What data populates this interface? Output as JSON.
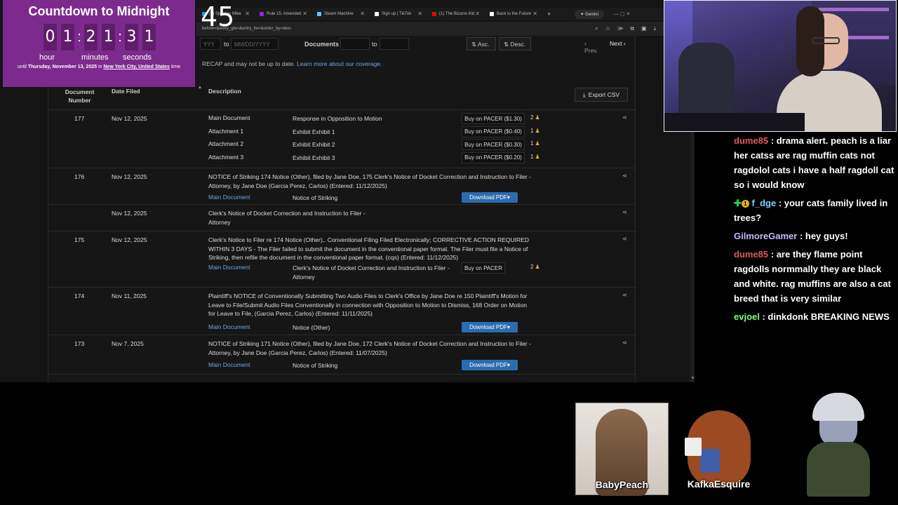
{
  "browser": {
    "tabs": [
      {
        "label": "(1) Speaker Mike",
        "color": "#1d9bf0"
      },
      {
        "label": "Rule 15: Amended",
        "color": "#8a2be2"
      },
      {
        "label": "Steam Machine",
        "color": "#66c0f4"
      },
      {
        "label": "Sign up | TikTok",
        "color": "#ffffff"
      },
      {
        "label": "(1) The Bizarre Kid",
        "color": "#ff0000"
      },
      {
        "label": "Back to the Future",
        "color": "#ffffff"
      }
    ],
    "gemini_label": "Gemini",
    "new_tab": "+",
    "window_controls": "—  ▢  ✕",
    "url": "before=&entry_gte=&entry_lte=&order_by=desc"
  },
  "controls": {
    "date_to_start_placeholder": "YYY",
    "to_label_1": "to",
    "date_end_placeholder": "MM/DD/YYYY",
    "documents_label": "Documents",
    "to_label_2": "to",
    "asc_label": "Asc.",
    "desc_label": "Desc.",
    "prev_label": "‹ Prev.",
    "next_label": "Next ›"
  },
  "notice": {
    "text": "RECAP and may not be up to date.",
    "link": "Learn more about our coverage."
  },
  "table": {
    "headers": {
      "doc_number_1": "Document",
      "doc_number_2": "Number",
      "date_filed": "Date Filed",
      "description": "Description"
    },
    "export_label": "Export CSV",
    "rows": [
      {
        "number": "177",
        "date": "Nov 12, 2025",
        "docs": [
          {
            "name": "Main Document",
            "desc": "Response in Opposition to Motion",
            "action": "Buy on PACER ($1.30)",
            "badge": "2"
          },
          {
            "name": "Attachment 1",
            "desc": "Exhibit Exhibit 1",
            "action": "Buy on PACER ($0.40)",
            "badge": "1"
          },
          {
            "name": "Attachment 2",
            "desc": "Exhibit Exhibit 2",
            "action": "Buy on PACER ($0.30)",
            "badge": "1"
          },
          {
            "name": "Attachment 3",
            "desc": "Exhibit Exhibit 3",
            "action": "Buy on PACER ($0.20)",
            "badge": "1"
          }
        ]
      },
      {
        "number": "176",
        "date": "Nov 12, 2025",
        "description": "NOTICE of Striking 174 Notice (Other), filed by Jane Doe, 175 Clerk's Notice of Docket Correction and Instruction to Filer - Attorney, by Jane Doe (Garcia Perez, Carlos) (Entered: 11/12/2025)",
        "doc_name": "Main Document",
        "doc_desc": "Notice of Striking",
        "action": "Download PDF"
      },
      {
        "number": "",
        "date": "Nov 12, 2025",
        "description": "Clerk's Notice of Docket Correction and Instruction to Filer - Attorney"
      },
      {
        "number": "175",
        "date": "Nov 12, 2025",
        "description": "Clerk's Notice to Filer re 174 Notice (Other),. Conventional Filing Filed Electronically; CORRECTIVE ACTION REQUIRED WITHIN 3 DAYS - The Filer failed to submit the document in the conventional paper format. The Filer must file a Notice of Striking, then refile the document in the conventional paper format. (cqs) (Entered: 11/12/2025)",
        "doc_name": "Main Document",
        "doc_desc": "Clerk's Notice of Docket Correction and Instruction to Filer - Attorney",
        "action": "Buy on PACER",
        "badge": "2"
      },
      {
        "number": "174",
        "date": "Nov 11, 2025",
        "description": "Plaintiff's NOTICE of Conventionally Submitting Two Audio Files to Clerk's Office by Jane Doe re 150 Plaintiff's Motion for Leave to File/Submit Audio Files Conventionally in connection with Opposition to Motion to Dismiss, 168 Order on Motion for Leave to File, (Garcia Perez, Carlos) (Entered: 11/11/2025)",
        "doc_name": "Main Document",
        "doc_desc": "Notice (Other)",
        "action": "Download PDF"
      },
      {
        "number": "173",
        "date": "Nov 7, 2025",
        "description": "NOTICE of Striking 171 Notice (Other), filed by Jane Doe, 172 Clerk's Notice of Docket Correction and Instruction to Filer - Attorney, by Jane Doe (Garcia Perez, Carlos) (Entered: 11/07/2025)",
        "doc_name": "Main Document",
        "doc_desc": "Notice of Striking",
        "action": "Download PDF"
      }
    ]
  },
  "countdown": {
    "title": "Countdown to Midnight",
    "digits": [
      "0",
      "1",
      "2",
      "1",
      "3",
      "1"
    ],
    "units": {
      "hour": "hour",
      "minutes": "minutes",
      "seconds": "seconds"
    },
    "until_prefix": "until",
    "until_date": "Thursday, November 13, 2025",
    "until_in": "in",
    "until_place": "New York City, United States",
    "until_suffix": "time",
    "big_seconds": "45"
  },
  "chat": [
    {
      "user": "dume85",
      "color": "#e05a5a",
      "text": "drama alert. peach is a liar her catss are rag muffin cats not ragdolol cats i have a half ragdoll cat so i would know"
    },
    {
      "user": "f_dge",
      "color": "#7fd3ff",
      "text": "your cats family lived in trees?",
      "badges": true
    },
    {
      "user": "GilmoreGamer",
      "color": "#c8b7ff",
      "text": "hey guys!"
    },
    {
      "user": "dume85",
      "color": "#e05a5a",
      "text": "are they flame point ragdolls normmally they are black and white. rag muffins are also a cat breed that is very similar"
    },
    {
      "user": "evjoel",
      "color": "#7fff7f",
      "text": "dinkdonk BREAKING NEWS"
    }
  ],
  "avatars": [
    {
      "name": "BabyPeach"
    },
    {
      "name": "KafkaEsquire"
    }
  ]
}
